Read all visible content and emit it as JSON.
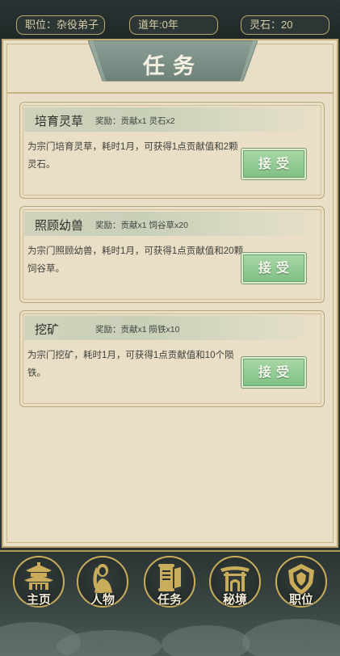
{
  "status_bar": {
    "position": "职位：杂役弟子",
    "age": "道年:0年",
    "spirit_stones": "灵石：20"
  },
  "page_title": "任务",
  "tasks": [
    {
      "name": "培育灵草",
      "reward": "奖励：贡献x1 灵石x2",
      "description": "为宗门培育灵草，耗时1月，可获得1点贡献值和2颗灵石。",
      "button_label": "接受"
    },
    {
      "name": "照顾幼兽",
      "reward": "奖励：贡献x1 饲谷草x20",
      "description": "为宗门照顾幼兽，耗时1月，可获得1点贡献值和20颗饲谷草。",
      "button_label": "接受"
    },
    {
      "name": "挖矿",
      "reward": "奖励：贡献x1 陨铁x10",
      "description": "为宗门挖矿，耗时1月，可获得1点贡献值和10个陨铁。",
      "button_label": "接受"
    }
  ],
  "nav": [
    {
      "label": "主页",
      "icon": "pavilion-icon"
    },
    {
      "label": "人物",
      "icon": "character-icon"
    },
    {
      "label": "任务",
      "icon": "scroll-icon"
    },
    {
      "label": "秘境",
      "icon": "gate-icon"
    },
    {
      "label": "职位",
      "icon": "rank-badge-icon"
    }
  ],
  "colors": {
    "parchment": "#e9dec6",
    "banner": "#7f948a",
    "accept_button": "#8cc68f",
    "gold_border": "#c9ad5a",
    "dark_ui": "#2b3635"
  }
}
